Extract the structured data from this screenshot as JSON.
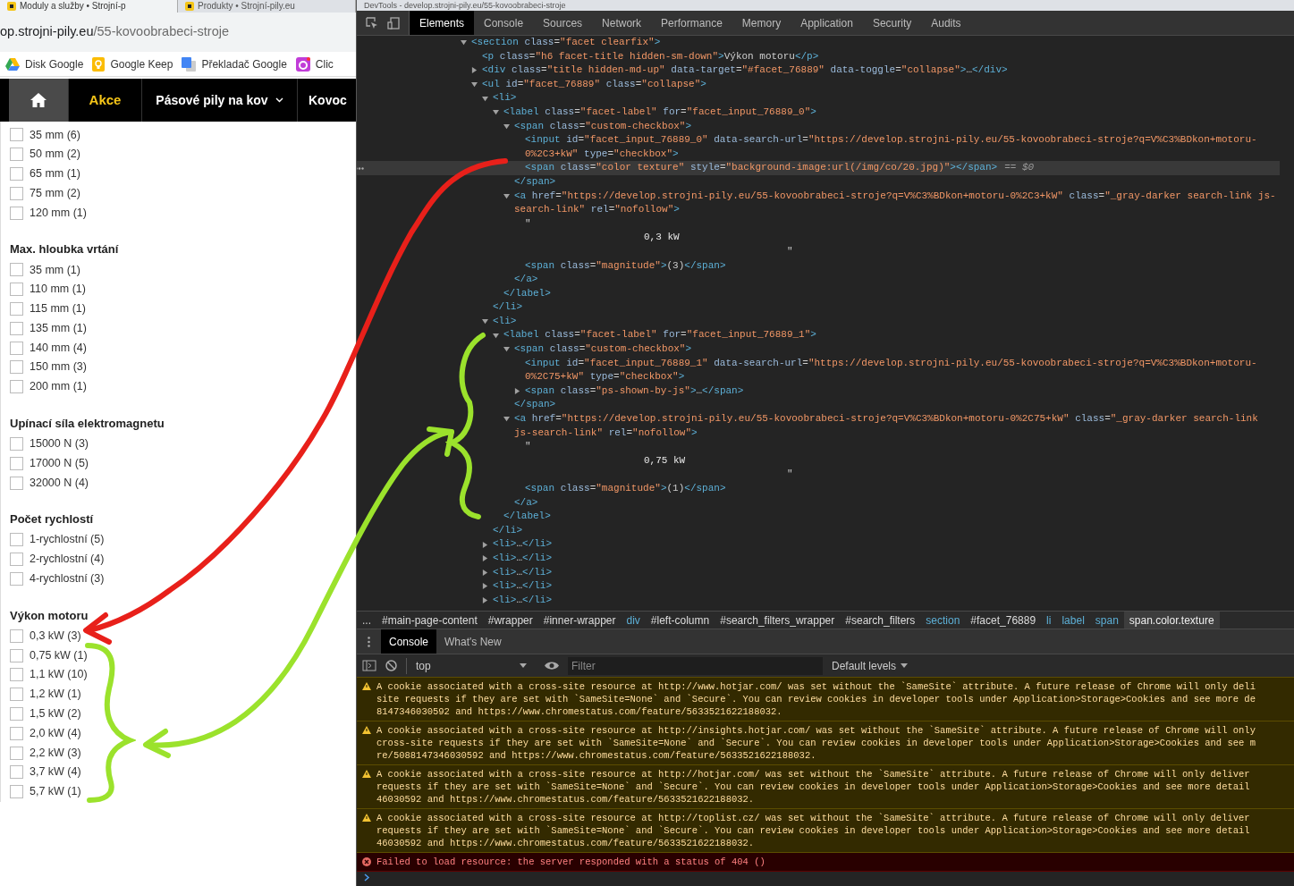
{
  "browser": {
    "tabs": [
      {
        "title": "Moduly a služby • Strojní-p",
        "selected": true
      },
      {
        "title": "Produkty • Strojní-pily.eu",
        "selected": false
      }
    ],
    "url_host": "op.strojni-pily.eu",
    "url_path": "/55-kovoobrabeci-stroje",
    "bookmarks": [
      {
        "kind": "drive",
        "label": "Disk Google"
      },
      {
        "kind": "keep",
        "label": "Google Keep"
      },
      {
        "kind": "translate",
        "label": "Překladač Google"
      },
      {
        "kind": "click",
        "label": "Clic"
      }
    ]
  },
  "site_nav": [
    {
      "kind": "home",
      "selected": true
    },
    {
      "kind": "promo",
      "label": "Akce",
      "selected": false
    },
    {
      "kind": "dropdown",
      "label": "Pásové pily na kov",
      "selected": false
    },
    {
      "kind": "link",
      "label": "Kovoc",
      "selected": false
    }
  ],
  "filters": [
    {
      "options": [
        {
          "label": "35 mm (6)",
          "checked": false
        },
        {
          "label": "50 mm (2)",
          "checked": false
        },
        {
          "label": "65 mm (1)",
          "checked": false
        },
        {
          "label": "75 mm (2)",
          "checked": false
        },
        {
          "label": "120 mm (1)",
          "checked": false
        }
      ]
    },
    {
      "title": "Max. hloubka vrtání",
      "options": [
        {
          "label": "35 mm (1)",
          "checked": false
        },
        {
          "label": "110 mm (1)",
          "checked": false
        },
        {
          "label": "115 mm (1)",
          "checked": false
        },
        {
          "label": "135 mm (1)",
          "checked": false
        },
        {
          "label": "140 mm (4)",
          "checked": false
        },
        {
          "label": "150 mm (3)",
          "checked": false
        },
        {
          "label": "200 mm (1)",
          "checked": false
        }
      ]
    },
    {
      "title": "Upínací síla elektromagnetu",
      "options": [
        {
          "label": "15000 N (3)",
          "checked": false
        },
        {
          "label": "17000 N (5)",
          "checked": false
        },
        {
          "label": "32000 N (4)",
          "checked": false
        }
      ]
    },
    {
      "title": "Počet rychlostí",
      "options": [
        {
          "label": "1-rychlostní (5)",
          "checked": false
        },
        {
          "label": "2-rychlostní (4)",
          "checked": false
        },
        {
          "label": "4-rychlostní (3)",
          "checked": false
        }
      ]
    },
    {
      "title": "Výkon motoru",
      "options": [
        {
          "label": "0,3 kW (3)",
          "checked": false
        },
        {
          "label": "0,75 kW (1)",
          "checked": false
        },
        {
          "label": "1,1 kW (10)",
          "checked": false
        },
        {
          "label": "1,2 kW (1)",
          "checked": false
        },
        {
          "label": "1,5 kW (2)",
          "checked": false
        },
        {
          "label": "2,0 kW (4)",
          "checked": false
        },
        {
          "label": "2,2 kW (3)",
          "checked": false
        },
        {
          "label": "3,7 kW (4)",
          "checked": false
        },
        {
          "label": "5,7 kW (1)",
          "checked": false
        }
      ]
    }
  ],
  "devtools": {
    "title": "DevTools - develop.strojni-pily.eu/55-kovoobrabeci-stroje",
    "tabs": [
      {
        "label": "Elements",
        "selected": true
      },
      {
        "label": "Console",
        "selected": false
      },
      {
        "label": "Sources",
        "selected": false
      },
      {
        "label": "Network",
        "selected": false
      },
      {
        "label": "Performance",
        "selected": false
      },
      {
        "label": "Memory",
        "selected": false
      },
      {
        "label": "Application",
        "selected": false
      },
      {
        "label": "Security",
        "selected": false
      },
      {
        "label": "Audits",
        "selected": false
      }
    ],
    "dom": [
      {
        "kind": "element",
        "text": "<section class=\"facet clearfix\">",
        "expanded": true,
        "selected": false,
        "children": [
          {
            "kind": "element",
            "text": "<p class=\"h6 facet-title hidden-sm-down\">Výkon motoru</p>",
            "selected": false
          },
          {
            "kind": "element",
            "text": "<div class=\"title hidden-md-up\" data-target=\"#facet_76889\" data-toggle=\"collapse\">…</div>",
            "expanded": false,
            "selected": false
          },
          {
            "kind": "element",
            "text": "<ul id=\"facet_76889\" class=\"collapse\">",
            "expanded": true,
            "selected": false,
            "children": [
              {
                "kind": "element",
                "text": "<li>",
                "expanded": true,
                "selected": false,
                "close": "</li>",
                "children": [
                  {
                    "kind": "element",
                    "text": "<label class=\"facet-label\" for=\"facet_input_76889_0\">",
                    "expanded": true,
                    "selected": false,
                    "close": "</label>",
                    "children": [
                      {
                        "kind": "element",
                        "text": "<span class=\"custom-checkbox\">",
                        "expanded": true,
                        "selected": false,
                        "close": "</span>",
                        "children": [
                          {
                            "kind": "element",
                            "text": "<input id=\"facet_input_76889_0\" data-search-url=\"https://develop.strojni-pily.eu/55-kovoobrabeci-stroje?q=V%C3%BDkon+motoru-0%2C3+kW\" type=\"checkbox\">",
                            "selected": false
                          },
                          {
                            "kind": "element",
                            "text": "<span class=\"color texture\" style=\"background-image:url(/img/co/20.jpg)\"></span>",
                            "selected": true,
                            "marker": "== $0"
                          }
                        ]
                      },
                      {
                        "kind": "element",
                        "text": "<a href=\"https://develop.strojni-pily.eu/55-kovoobrabeci-stroje?q=V%C3%BDkon+motoru-0%2C3+kW\" class=\"_gray-darker search-link js-search-link\" rel=\"nofollow\">",
                        "expanded": true,
                        "selected": false,
                        "close": "</a>",
                        "children": [
                          {
                            "kind": "quote_open",
                            "text": "\"",
                            "selected": false
                          },
                          {
                            "kind": "text_value",
                            "text": "0,3 kW",
                            "selected": false
                          },
                          {
                            "kind": "quote_close",
                            "text": "\"",
                            "selected": false
                          },
                          {
                            "kind": "element",
                            "text": "<span class=\"magnitude\">(3)</span>",
                            "selected": false
                          }
                        ]
                      }
                    ]
                  }
                ]
              },
              {
                "kind": "element",
                "text": "<li>",
                "expanded": true,
                "selected": false,
                "close": "</li>",
                "children": [
                  {
                    "kind": "element",
                    "text": "<label class=\"facet-label\" for=\"facet_input_76889_1\">",
                    "expanded": true,
                    "selected": false,
                    "close": "</label>",
                    "children": [
                      {
                        "kind": "element",
                        "text": "<span class=\"custom-checkbox\">",
                        "expanded": true,
                        "selected": false,
                        "close": "</span>",
                        "children": [
                          {
                            "kind": "element",
                            "text": "<input id=\"facet_input_76889_1\" data-search-url=\"https://develop.strojni-pily.eu/55-kovoobrabeci-stroje?q=V%C3%BDkon+motoru-0%2C75+kW\" type=\"checkbox\">",
                            "selected": false
                          },
                          {
                            "kind": "element",
                            "text": "<span class=\"ps-shown-by-js\">…</span>",
                            "expanded": false,
                            "selected": false
                          }
                        ]
                      },
                      {
                        "kind": "element",
                        "text": "<a href=\"https://develop.strojni-pily.eu/55-kovoobrabeci-stroje?q=V%C3%BDkon+motoru-0%2C75+kW\" class=\"_gray-darker search-link js-search-link\" rel=\"nofollow\">",
                        "expanded": true,
                        "selected": false,
                        "close": "</a>",
                        "children": [
                          {
                            "kind": "quote_open",
                            "text": "\"",
                            "selected": false
                          },
                          {
                            "kind": "text_value",
                            "text": "0,75 kW",
                            "selected": false
                          },
                          {
                            "kind": "quote_close",
                            "text": "\"",
                            "selected": false
                          },
                          {
                            "kind": "element",
                            "text": "<span class=\"magnitude\">(1)</span>",
                            "selected": false
                          }
                        ]
                      }
                    ]
                  }
                ]
              },
              {
                "kind": "element",
                "text": "<li>…</li>",
                "expanded": false,
                "selected": false
              },
              {
                "kind": "element",
                "text": "<li>…</li>",
                "expanded": false,
                "selected": false
              },
              {
                "kind": "element",
                "text": "<li>…</li>",
                "expanded": false,
                "selected": false
              },
              {
                "kind": "element",
                "text": "<li>…</li>",
                "expanded": false,
                "selected": false
              },
              {
                "kind": "element",
                "text": "<li>…</li>",
                "expanded": false,
                "selected": false
              }
            ]
          }
        ]
      }
    ],
    "breadcrumb_overflow": "...",
    "breadcrumbs": [
      {
        "label": "#main-page-content",
        "selected": false
      },
      {
        "label": "#wrapper",
        "selected": false
      },
      {
        "label": "#inner-wrapper",
        "selected": false
      },
      {
        "label": "div",
        "selected": false
      },
      {
        "label": "#left-column",
        "selected": false
      },
      {
        "label": "#search_filters_wrapper",
        "selected": false
      },
      {
        "label": "#search_filters",
        "selected": false
      },
      {
        "label": "section",
        "selected": false
      },
      {
        "label": "#facet_76889",
        "selected": false
      },
      {
        "label": "li",
        "selected": false
      },
      {
        "label": "label",
        "selected": false
      },
      {
        "label": "span",
        "selected": false
      },
      {
        "label": "span.color.texture",
        "selected": true
      }
    ],
    "drawer_tabs": [
      {
        "label": "Console",
        "selected": true
      },
      {
        "label": "What's New",
        "selected": false
      }
    ],
    "console_context": "top",
    "filter_placeholder": "Filter",
    "levels": "Default levels",
    "messages": [
      {
        "kind": "warning",
        "lines": [
          "A cookie associated with a cross-site resource at http://www.hotjar.com/ was set without the `SameSite` attribute. A future release of Chrome will only deli",
          "site requests if they are set with `SameSite=None` and `Secure`. You can review cookies in developer tools under Application>Storage>Cookies and see more de",
          "8147346030592 and https://www.chromestatus.com/feature/5633521622188032."
        ]
      },
      {
        "kind": "warning",
        "lines": [
          "A cookie associated with a cross-site resource at http://insights.hotjar.com/ was set without the `SameSite` attribute. A future release of Chrome will only",
          "cross-site requests if they are set with `SameSite=None` and `Secure`. You can review cookies in developer tools under Application>Storage>Cookies and see m",
          "re/5088147346030592 and https://www.chromestatus.com/feature/5633521622188032."
        ]
      },
      {
        "kind": "warning",
        "lines": [
          "A cookie associated with a cross-site resource at http://hotjar.com/ was set without the `SameSite` attribute. A future release of Chrome will only deliver",
          "requests if they are set with `SameSite=None` and `Secure`. You can review cookies in developer tools under Application>Storage>Cookies and see more detail",
          "46030592 and https://www.chromestatus.com/feature/5633521622188032."
        ]
      },
      {
        "kind": "warning",
        "lines": [
          "A cookie associated with a cross-site resource at http://toplist.cz/ was set without the `SameSite` attribute. A future release of Chrome will only deliver",
          "requests if they are set with `SameSite=None` and `Secure`. You can review cookies in developer tools under Application>Storage>Cookies and see more detail",
          "46030592 and https://www.chromestatus.com/feature/5633521622188032."
        ]
      },
      {
        "kind": "error",
        "lines": [
          "Failed to load resource: the server responded with a status of 404 ()"
        ]
      }
    ]
  }
}
